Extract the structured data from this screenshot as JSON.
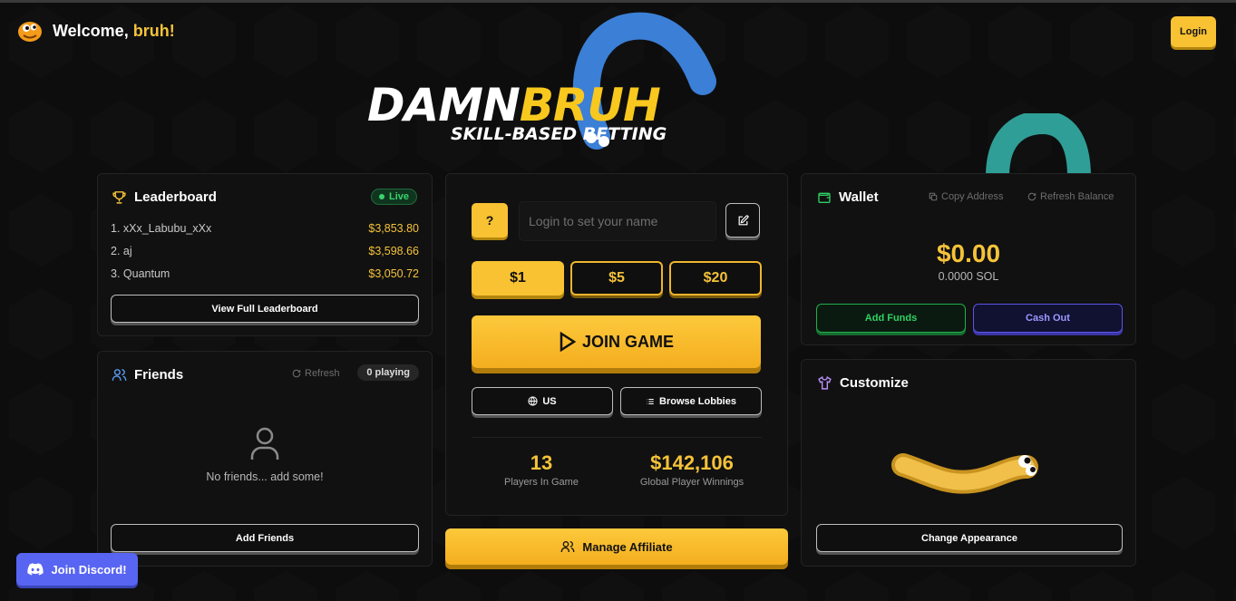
{
  "header": {
    "welcome_prefix": "Welcome, ",
    "username": "bruh!",
    "login_label": "Login"
  },
  "logo": {
    "part1": "DAMN",
    "part2": "BRUH",
    "tagline": "SKILL-BASED BETTING"
  },
  "leaderboard": {
    "title": "Leaderboard",
    "live_label": "Live",
    "rows": [
      {
        "name": "1. xXx_Labubu_xXx",
        "amount": "$3,853.80"
      },
      {
        "name": "2. aj",
        "amount": "$3,598.66"
      },
      {
        "name": "3. Quantum",
        "amount": "$3,050.72"
      }
    ],
    "view_full_label": "View Full Leaderboard"
  },
  "friends": {
    "title": "Friends",
    "refresh_label": "Refresh",
    "playing_label": "0 playing",
    "empty_text": "No friends... add some!",
    "add_label": "Add Friends"
  },
  "play": {
    "help_label": "?",
    "name_placeholder": "Login to set your name",
    "bets": [
      "$1",
      "$5",
      "$20"
    ],
    "selected_bet": "$1",
    "join_label": "JOIN GAME",
    "region_label": "US",
    "browse_label": "Browse Lobbies",
    "players_count": "13",
    "players_label": "Players In Game",
    "winnings_value": "$142,106",
    "winnings_label": "Global Player Winnings",
    "affiliate_label": "Manage Affiliate"
  },
  "wallet": {
    "title": "Wallet",
    "copy_label": "Copy Address",
    "refresh_label": "Refresh Balance",
    "balance": "$0.00",
    "sol": "0.0000 SOL",
    "add_funds_label": "Add Funds",
    "cash_out_label": "Cash Out"
  },
  "customize": {
    "title": "Customize",
    "change_label": "Change Appearance"
  },
  "discord": {
    "label": "Join Discord!"
  },
  "colors": {
    "accent": "#f8c232",
    "green": "#2fd163",
    "purple": "#5865f2"
  }
}
